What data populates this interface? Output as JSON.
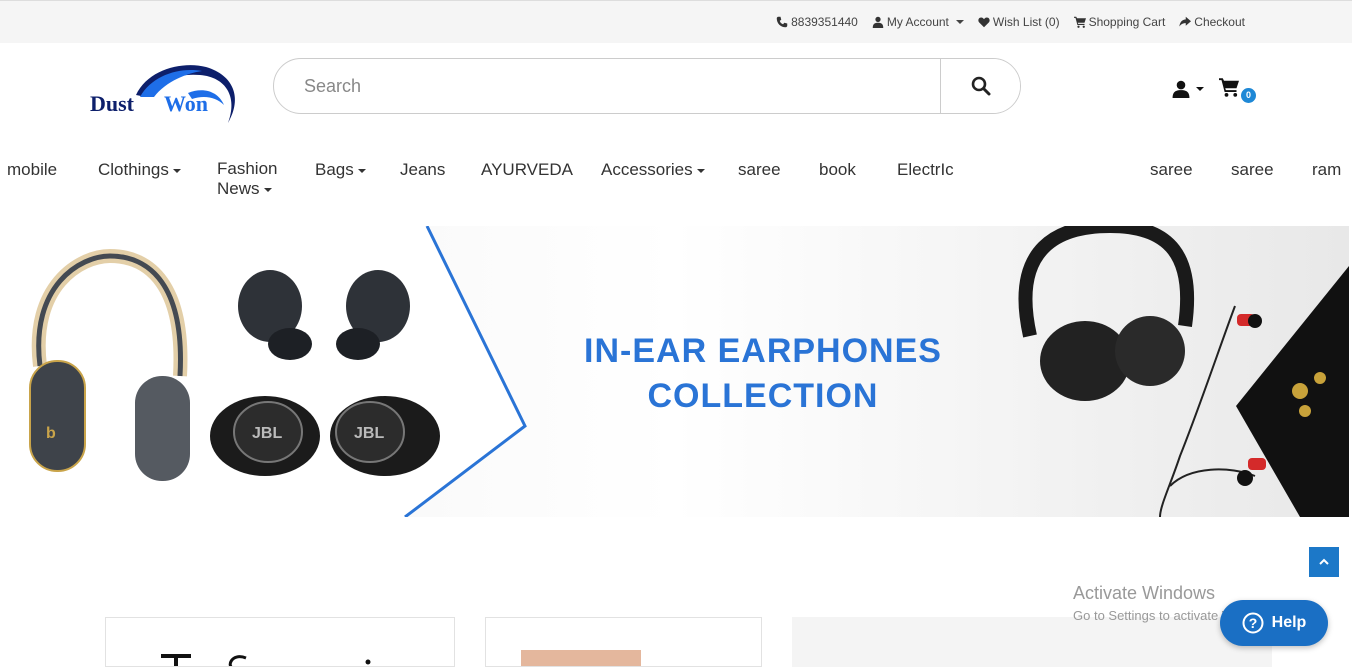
{
  "topbar": {
    "phone": "8839351440",
    "my_account": "My Account",
    "wish_list": "Wish List (0)",
    "shopping_cart": "Shopping Cart",
    "checkout": "Checkout"
  },
  "header": {
    "logo_text_1": "Dust",
    "logo_text_2": "Won",
    "search_placeholder": "Search",
    "cart_count": "0"
  },
  "nav": {
    "items": [
      {
        "label": "mobile",
        "dropdown": false
      },
      {
        "label": "Clothings",
        "dropdown": true
      },
      {
        "label": "Fashion",
        "label2": "News",
        "dropdown": true
      },
      {
        "label": "Bags",
        "dropdown": true
      },
      {
        "label": "Jeans",
        "dropdown": false
      },
      {
        "label": "AYURVEDA",
        "dropdown": false
      },
      {
        "label": "Accessories",
        "dropdown": true
      },
      {
        "label": "saree",
        "dropdown": false
      },
      {
        "label": "book",
        "dropdown": false
      },
      {
        "label": "ElectrIc",
        "dropdown": false
      },
      {
        "label": "saree",
        "dropdown": false
      },
      {
        "label": "saree",
        "dropdown": false
      },
      {
        "label": "ram",
        "dropdown": false
      }
    ]
  },
  "banner": {
    "title_line1": "IN-EAR EARPHONES",
    "title_line2": "COLLECTION",
    "product_brand": "JBL"
  },
  "watermark": {
    "line1": "Activate Windows",
    "line2": "Go to Settings to activate Windows."
  },
  "help": {
    "label": "Help"
  },
  "colors": {
    "accent": "#2a74d6",
    "logo_navy": "#0d1f6b",
    "help_button": "#1a6fc4",
    "badge": "#1e88d6"
  }
}
